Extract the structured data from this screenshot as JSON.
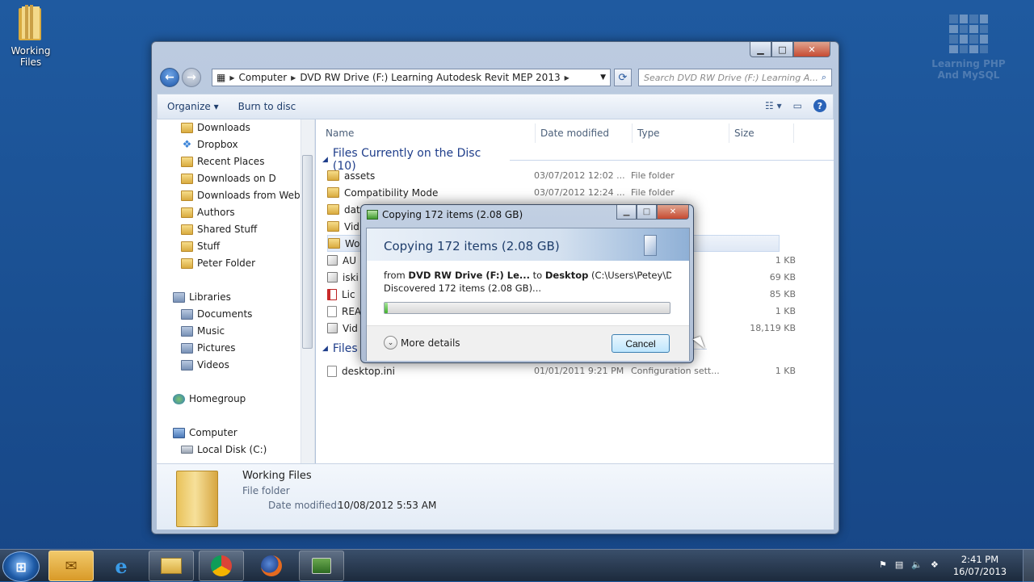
{
  "desktop": {
    "icon_label": "Working Files",
    "watermark_line1": "Learning PHP",
    "watermark_line2": "And MySQL"
  },
  "explorer": {
    "caption": {
      "minimize": "▁",
      "maximize": "□",
      "close": "✕"
    },
    "address": {
      "segments": [
        "Computer",
        "DVD RW Drive (F:) Learning Autodesk Revit MEP 2013"
      ]
    },
    "search_placeholder": "Search DVD RW Drive (F:) Learning A...",
    "toolbar": {
      "organize": "Organize ▾",
      "burn": "Burn to disc"
    },
    "nav": {
      "favorites": [
        "Downloads",
        "Dropbox",
        "Recent Places",
        "Downloads on D",
        "Downloads from Web",
        "Authors",
        "Shared Stuff",
        "Stuff",
        "Peter Folder"
      ],
      "libraries": "Libraries",
      "library_items": [
        "Documents",
        "Music",
        "Pictures",
        "Videos"
      ],
      "homegroup": "Homegroup",
      "computer": "Computer",
      "computer_items": [
        "Local Disk (C:)"
      ]
    },
    "columns": {
      "name": "Name",
      "date": "Date modified",
      "type": "Type",
      "size": "Size"
    },
    "group1": "Files Currently on the Disc (10)",
    "group2": "Files",
    "rows": [
      {
        "name": "assets",
        "date": "03/07/2012 12:02 ...",
        "type": "File folder",
        "size": ""
      },
      {
        "name": "Compatibility Mode",
        "date": "03/07/2012 12:24 ...",
        "type": "File folder",
        "size": ""
      },
      {
        "name": "dat",
        "date": "",
        "type": "",
        "size": ""
      },
      {
        "name": "Vid",
        "date": "",
        "type": "",
        "size": ""
      },
      {
        "name": "Wo",
        "date": "",
        "type": "",
        "size": ""
      },
      {
        "name": "AU",
        "date": "",
        "type": "ation",
        "size": "1 KB"
      },
      {
        "name": "iski",
        "date": "",
        "type": "",
        "size": "69 KB"
      },
      {
        "name": "Lic",
        "date": "",
        "type": "at D...",
        "size": "85 KB"
      },
      {
        "name": "REA",
        "date": "",
        "type": "nt",
        "size": "1 KB"
      },
      {
        "name": "Vid",
        "date": "",
        "type": "",
        "size": "18,119 KB"
      }
    ],
    "group2_rows": [
      {
        "name": "desktop.ini",
        "date": "01/01/2011 9:21 PM",
        "type": "Configuration sett...",
        "size": "1 KB"
      }
    ],
    "details": {
      "name": "Working Files",
      "kind": "File folder",
      "date_label": "Date modified:",
      "date_value": "10/08/2012 5:53 AM"
    }
  },
  "copy_dialog": {
    "title": "Copying 172 items (2.08 GB)",
    "heading": "Copying 172 items (2.08 GB)",
    "from_word": "from",
    "from_src": "DVD RW Drive (F:) Le...",
    "to_word": "to",
    "to_dest": "Desktop",
    "to_path": "(C:\\Users\\Petey\\Desktop",
    "status": "Discovered 172 items (2.08 GB)...",
    "progress": 0.01,
    "more_details": "More details",
    "cancel": "Cancel"
  },
  "taskbar": {
    "time": "2:41 PM",
    "date": "16/07/2013"
  },
  "colors": {
    "accent": "#1e3d6b",
    "progress": "#42b02c",
    "desktop": "#1f5aa0"
  }
}
